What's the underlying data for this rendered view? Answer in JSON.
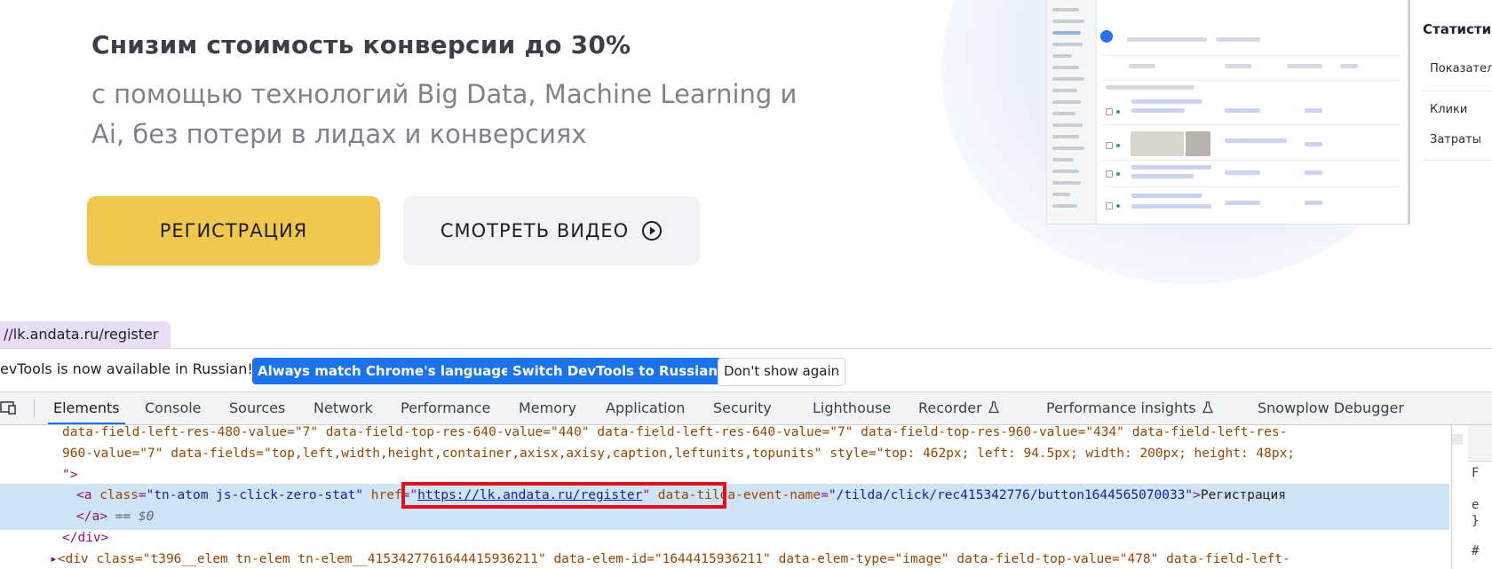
{
  "hero": {
    "headline": "Снизим стоимость конверсии до 30%",
    "subheadline": "с помощью технологий Big Data, Machine Learning и Ai, без потери в лидах и конверсиях",
    "register_button": "РЕГИСТРАЦИЯ",
    "video_button": "СМОТРЕТЬ ВИДЕО"
  },
  "stats_panel": {
    "title": "Статисти",
    "rows": [
      "Показател",
      "Клики",
      "Затраты"
    ]
  },
  "url_tooltip": "//lk.andata.ru/register",
  "devtools": {
    "infobar": {
      "text": "evTools is now available in Russian!",
      "match_button": "Always match Chrome's language",
      "switch_button": "Switch DevTools to Russian",
      "dismiss_button": "Don't show again"
    },
    "tabs": [
      {
        "label": "Elements",
        "active": true
      },
      {
        "label": "Console"
      },
      {
        "label": "Sources"
      },
      {
        "label": "Network"
      },
      {
        "label": "Performance"
      },
      {
        "label": "Memory"
      },
      {
        "label": "Application"
      },
      {
        "label": "Security"
      },
      {
        "label": "Lighthouse"
      },
      {
        "label": "Recorder"
      },
      {
        "label": "Performance insights"
      },
      {
        "label": "Snowplow Debugger"
      }
    ],
    "code": {
      "line1": "data-field-left-res-480-value=\"7\" data-field-top-res-640-value=\"440\" data-field-left-res-640-value=\"7\" data-field-top-res-960-value=\"434\" data-field-left-res-",
      "line2": "960-value=\"7\" data-fields=\"top,left,width,height,container,axisx,axisy,caption,leftunits,topunits\" style=\"top: 462px; left: 94.5px; width: 200px; height: 48px;",
      "line3": "\">",
      "a_open": "<a ",
      "a_class_attr": "class",
      "a_class_val": "\"tn-atom js-click-zero-stat\"",
      "a_href_attr": "href",
      "a_href_val": "https://lk.andata.ru/register",
      "a_event_attr": "data-tilda-event-name",
      "a_event_val": "\"/tilda/click/rec415342776/button1644565070033\"",
      "a_text": "Регистрация",
      "a_close": "</a>",
      "selected_marker": "== $0",
      "div_close": "</div>",
      "line_last": "<div class=\"t396__elem tn-elem tn-elem__4153427761644415936211\" data-elem-id=\"1644415936211\" data-elem-type=\"image\" data-field-top-value=\"478\" data-field-left-"
    },
    "side_pane": [
      "F",
      "e",
      "}",
      "#"
    ]
  },
  "colors": {
    "accent_yellow": "#f0c84e",
    "devtools_blue": "#1a73e8",
    "highlight_red": "#e3101a",
    "selection": "#cfe4f7"
  }
}
